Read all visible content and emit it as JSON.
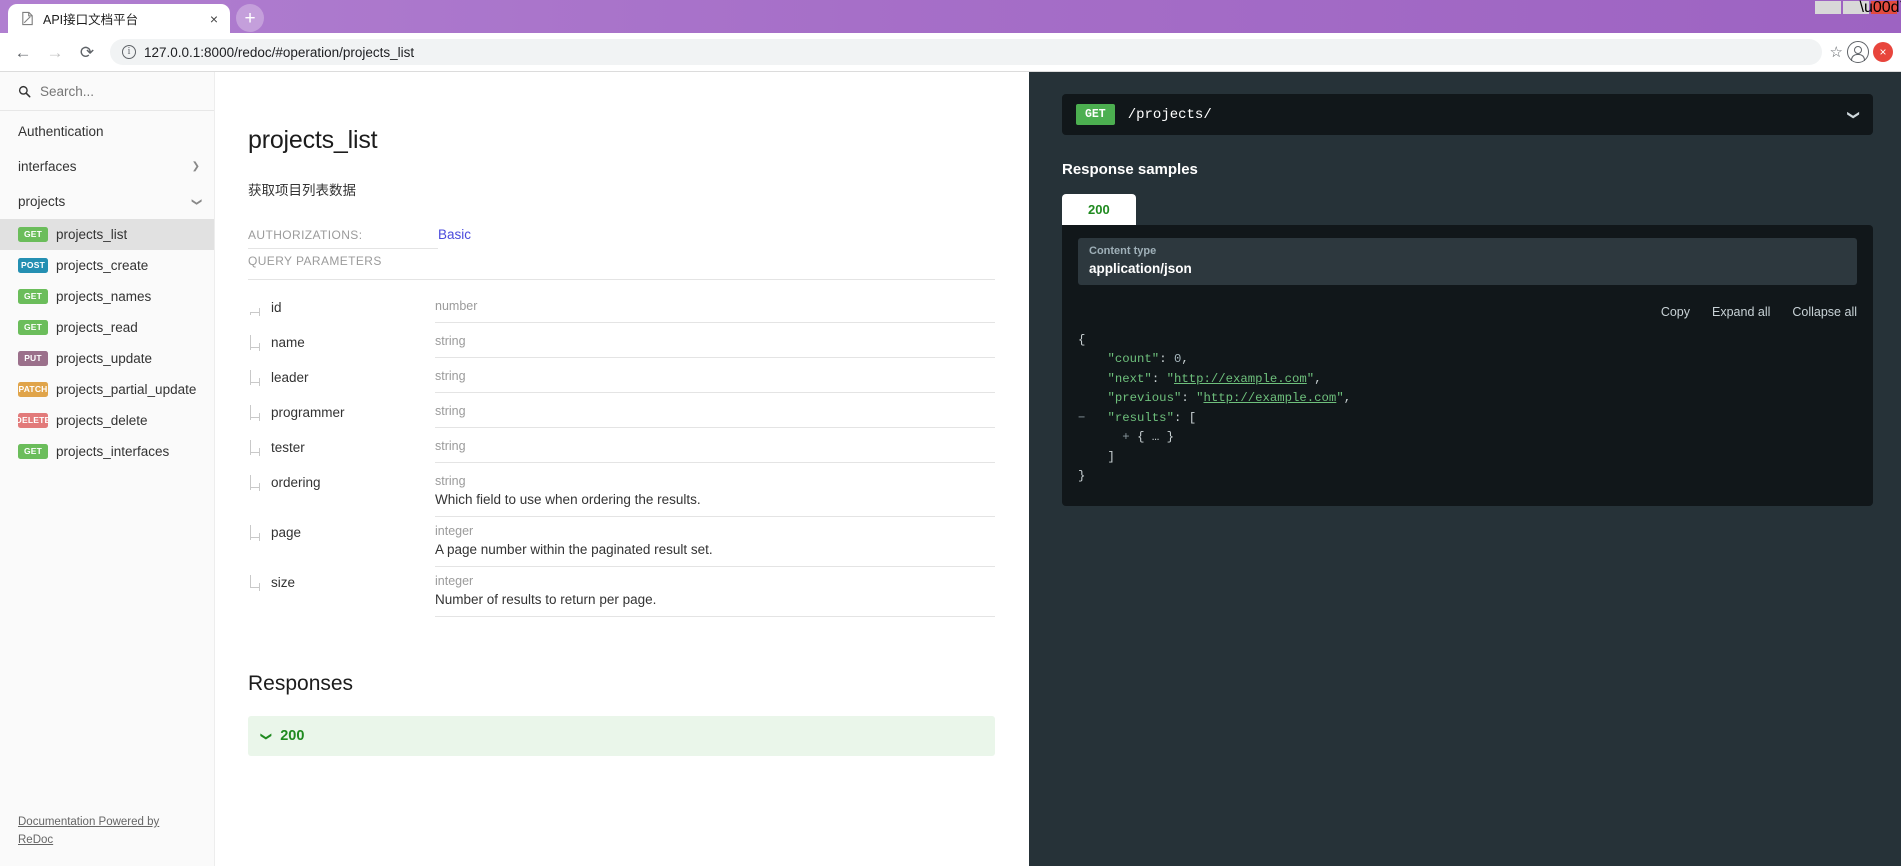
{
  "browser": {
    "tab": {
      "title": "API接口文档平台",
      "favicon": "page-icon",
      "close": "×"
    },
    "newtab_label": "+",
    "window_controls": {
      "minimize": "minimize-icon",
      "maximize": "maximize-icon",
      "close": "close-icon"
    },
    "nav": {
      "back": "←",
      "forward": "→",
      "reload": "⟳"
    },
    "url": {
      "host": "127.0.0.1:8000",
      "path": "/redoc/#operation/projects_list",
      "full": "127.0.0.1:8000/redoc/#operation/projects_list"
    },
    "bookmark": "☆",
    "extension_badge": "×"
  },
  "sidebar": {
    "search_placeholder": "Search...",
    "groups": [
      {
        "label": "Authentication",
        "chevron": ""
      },
      {
        "label": "interfaces",
        "chevron": "right"
      },
      {
        "label": "projects",
        "chevron": "down"
      }
    ],
    "items": [
      {
        "verb": "GET",
        "verb_class": "get",
        "label": "projects_list",
        "active": true
      },
      {
        "verb": "POST",
        "verb_class": "post",
        "label": "projects_create",
        "active": false
      },
      {
        "verb": "GET",
        "verb_class": "get",
        "label": "projects_names",
        "active": false
      },
      {
        "verb": "GET",
        "verb_class": "get",
        "label": "projects_read",
        "active": false
      },
      {
        "verb": "PUT",
        "verb_class": "put",
        "label": "projects_update",
        "active": false
      },
      {
        "verb": "PATCH",
        "verb_class": "patch",
        "label": "projects_partial_update",
        "active": false
      },
      {
        "verb": "DELETE",
        "verb_class": "delete",
        "label": "projects_delete",
        "active": false
      },
      {
        "verb": "GET",
        "verb_class": "get",
        "label": "projects_interfaces",
        "active": false
      }
    ],
    "footer_link": "Documentation Powered by ReDoc"
  },
  "content": {
    "title": "projects_list",
    "description": "获取项目列表数据",
    "authorizations_label": "AUTHORIZATIONS:",
    "authorizations_value": "Basic",
    "query_parameters_label": "QUERY PARAMETERS",
    "parameters": [
      {
        "name": "id",
        "type": "number",
        "desc": ""
      },
      {
        "name": "name",
        "type": "string",
        "desc": ""
      },
      {
        "name": "leader",
        "type": "string",
        "desc": ""
      },
      {
        "name": "programmer",
        "type": "string",
        "desc": ""
      },
      {
        "name": "tester",
        "type": "string",
        "desc": ""
      },
      {
        "name": "ordering",
        "type": "string",
        "desc": "Which field to use when ordering the results."
      },
      {
        "name": "page",
        "type": "integer",
        "desc": "A page number within the paginated result set."
      },
      {
        "name": "size",
        "type": "integer",
        "desc": "Number of results to return per page."
      }
    ],
    "responses_title": "Responses",
    "response_code": "200"
  },
  "right_panel": {
    "endpoint_verb": "GET",
    "endpoint_path": "/projects/",
    "samples_title": "Response samples",
    "code_tab": "200",
    "content_type_label": "Content type",
    "content_type_value": "application/json",
    "actions": {
      "copy": "Copy",
      "expand": "Expand all",
      "collapse": "Collapse all"
    },
    "json": {
      "open_brace": "{",
      "close_brace": "}",
      "count_key": "\"count\"",
      "count_value": "0",
      "next_key": "\"next\"",
      "next_value": "http://example.com",
      "previous_key": "\"previous\"",
      "previous_value": "http://example.com",
      "results_key": "\"results\"",
      "results_open": "[",
      "results_item": "{ … }",
      "results_close": "]",
      "toggle_minus": "−",
      "toggle_plus": "+"
    }
  },
  "colors": {
    "accent_purple": "#9d63c2",
    "get_green": "#6bbd5b",
    "post_blue": "#248fb2",
    "put_purple": "#9b708b",
    "patch_orange": "#e0a44a",
    "delete_red": "#e27a7a",
    "panel_dark": "#263238",
    "code_dark": "#11171a"
  }
}
